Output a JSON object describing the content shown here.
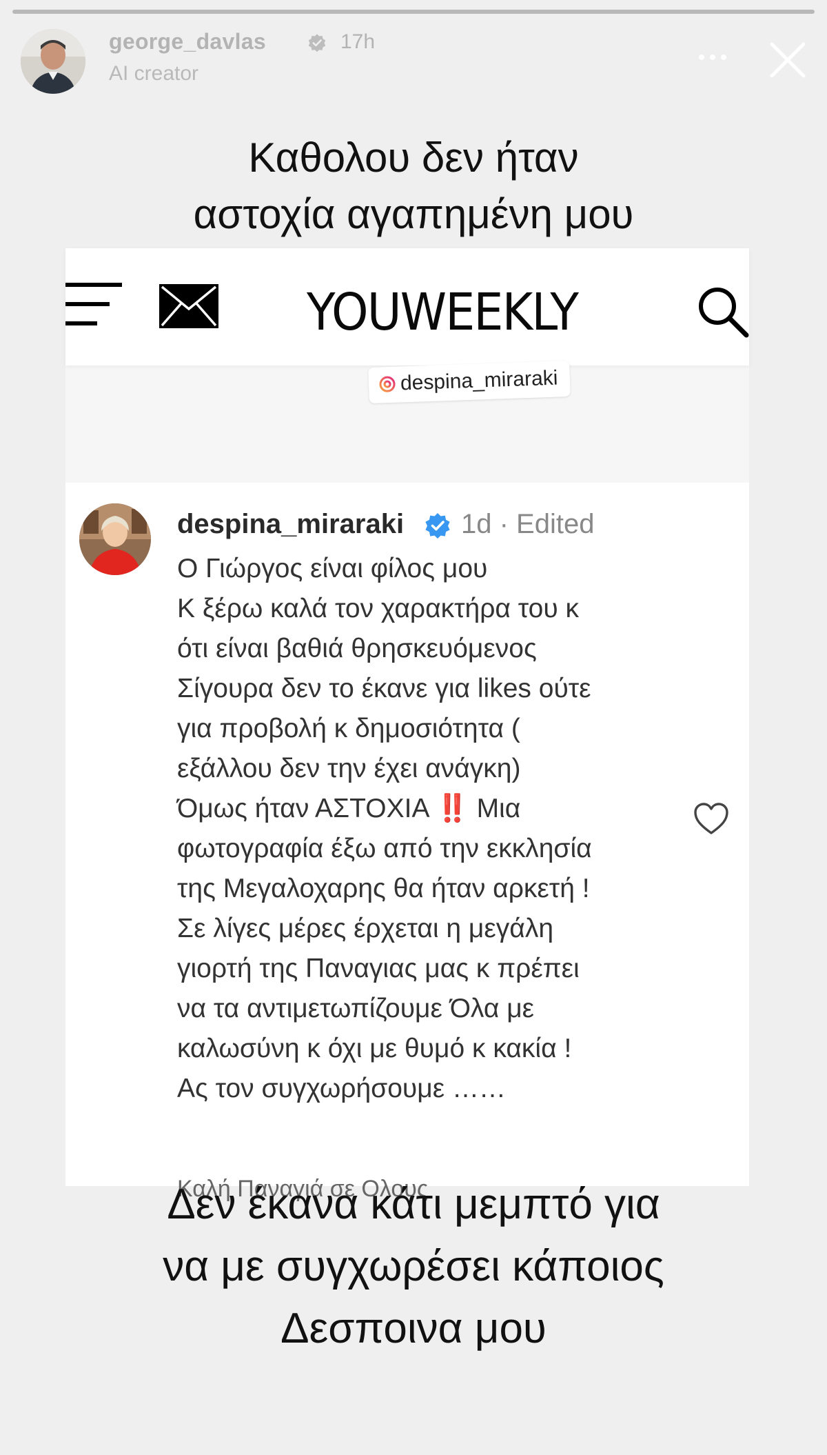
{
  "story": {
    "progress": 1.0,
    "username": "george_davlas",
    "time": "17h",
    "subtitle": "AI creator",
    "caption_top": [
      "Καθολου δεν ήταν",
      "αστοχία αγαπημένη μου"
    ],
    "caption_bottom": [
      "Δεν έκανα κάτι μεμπτό για",
      "να με συγχωρέσει κάποιος",
      "Δεσποινα μου"
    ]
  },
  "site": {
    "brand": "YOUWEEKLY"
  },
  "mention": {
    "handle": "despina_miraraki"
  },
  "comment": {
    "username": "despina_miraraki",
    "time": "1d · Edited",
    "lines": [
      "Ο Γιώργος είναι φίλος μου",
      "Κ ξέρω καλά τον χαρακτήρα του κ",
      "ότι είναι βαθιά θρησκευόμενος",
      "Σίγουρα δεν το έκανε για likes ούτε",
      "για προβολή κ δημοσιότητα (",
      "εξάλλου δεν την έχει ανάγκη)",
      "Όμως ήταν ΑΣΤΟΧΙΑ",
      "φωτογραφία έξω από την εκκλησία",
      "της Μεγαλοχαρης θα ήταν αρκετή !",
      "Σε λίγες μέρες έρχεται η μεγάλη",
      "γιορτή της Παναγιας μας κ πρέπει",
      "να τα αντιμετωπίζουμε Όλα με",
      "καλωσύνη κ όχι με θυμό κ κακία !",
      "Ας τον συγχωρήσουμε ……"
    ],
    "line7_emoji": "‼️",
    "line7_suffix": "Μια",
    "signoff": "Καλή Παναγιά σε Ολους"
  },
  "icons": {
    "verified_color": "#3897f0",
    "alert_color": "#e7305f"
  }
}
